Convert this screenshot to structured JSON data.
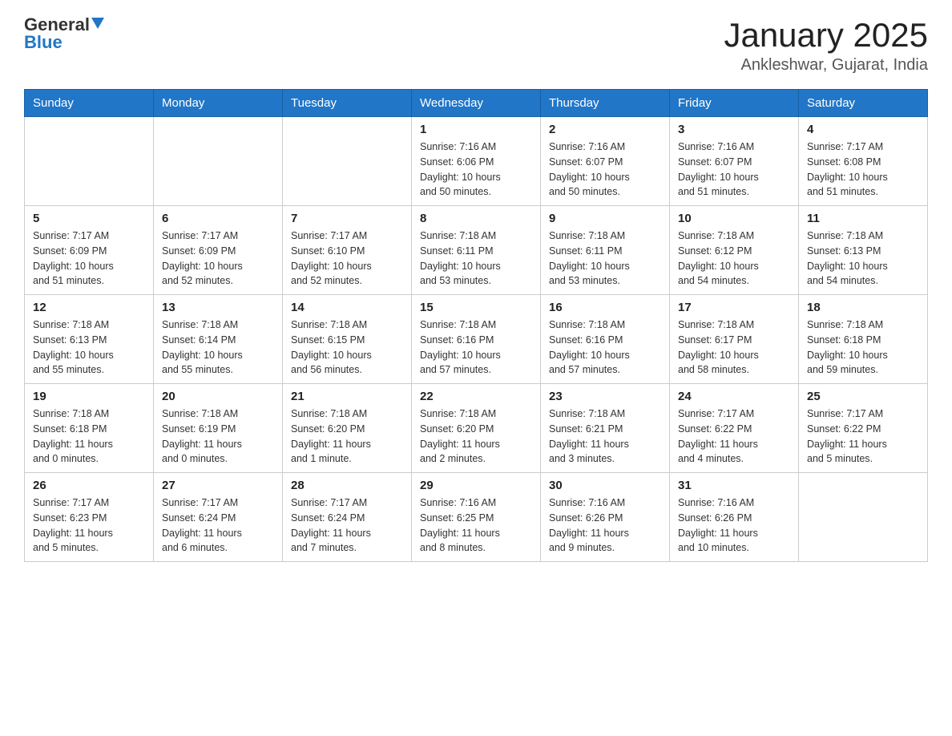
{
  "header": {
    "logo_general": "General",
    "logo_blue": "Blue",
    "title": "January 2025",
    "subtitle": "Ankleshwar, Gujarat, India"
  },
  "calendar": {
    "days_of_week": [
      "Sunday",
      "Monday",
      "Tuesday",
      "Wednesday",
      "Thursday",
      "Friday",
      "Saturday"
    ],
    "weeks": [
      [
        {
          "day": "",
          "info": ""
        },
        {
          "day": "",
          "info": ""
        },
        {
          "day": "",
          "info": ""
        },
        {
          "day": "1",
          "info": "Sunrise: 7:16 AM\nSunset: 6:06 PM\nDaylight: 10 hours\nand 50 minutes."
        },
        {
          "day": "2",
          "info": "Sunrise: 7:16 AM\nSunset: 6:07 PM\nDaylight: 10 hours\nand 50 minutes."
        },
        {
          "day": "3",
          "info": "Sunrise: 7:16 AM\nSunset: 6:07 PM\nDaylight: 10 hours\nand 51 minutes."
        },
        {
          "day": "4",
          "info": "Sunrise: 7:17 AM\nSunset: 6:08 PM\nDaylight: 10 hours\nand 51 minutes."
        }
      ],
      [
        {
          "day": "5",
          "info": "Sunrise: 7:17 AM\nSunset: 6:09 PM\nDaylight: 10 hours\nand 51 minutes."
        },
        {
          "day": "6",
          "info": "Sunrise: 7:17 AM\nSunset: 6:09 PM\nDaylight: 10 hours\nand 52 minutes."
        },
        {
          "day": "7",
          "info": "Sunrise: 7:17 AM\nSunset: 6:10 PM\nDaylight: 10 hours\nand 52 minutes."
        },
        {
          "day": "8",
          "info": "Sunrise: 7:18 AM\nSunset: 6:11 PM\nDaylight: 10 hours\nand 53 minutes."
        },
        {
          "day": "9",
          "info": "Sunrise: 7:18 AM\nSunset: 6:11 PM\nDaylight: 10 hours\nand 53 minutes."
        },
        {
          "day": "10",
          "info": "Sunrise: 7:18 AM\nSunset: 6:12 PM\nDaylight: 10 hours\nand 54 minutes."
        },
        {
          "day": "11",
          "info": "Sunrise: 7:18 AM\nSunset: 6:13 PM\nDaylight: 10 hours\nand 54 minutes."
        }
      ],
      [
        {
          "day": "12",
          "info": "Sunrise: 7:18 AM\nSunset: 6:13 PM\nDaylight: 10 hours\nand 55 minutes."
        },
        {
          "day": "13",
          "info": "Sunrise: 7:18 AM\nSunset: 6:14 PM\nDaylight: 10 hours\nand 55 minutes."
        },
        {
          "day": "14",
          "info": "Sunrise: 7:18 AM\nSunset: 6:15 PM\nDaylight: 10 hours\nand 56 minutes."
        },
        {
          "day": "15",
          "info": "Sunrise: 7:18 AM\nSunset: 6:16 PM\nDaylight: 10 hours\nand 57 minutes."
        },
        {
          "day": "16",
          "info": "Sunrise: 7:18 AM\nSunset: 6:16 PM\nDaylight: 10 hours\nand 57 minutes."
        },
        {
          "day": "17",
          "info": "Sunrise: 7:18 AM\nSunset: 6:17 PM\nDaylight: 10 hours\nand 58 minutes."
        },
        {
          "day": "18",
          "info": "Sunrise: 7:18 AM\nSunset: 6:18 PM\nDaylight: 10 hours\nand 59 minutes."
        }
      ],
      [
        {
          "day": "19",
          "info": "Sunrise: 7:18 AM\nSunset: 6:18 PM\nDaylight: 11 hours\nand 0 minutes."
        },
        {
          "day": "20",
          "info": "Sunrise: 7:18 AM\nSunset: 6:19 PM\nDaylight: 11 hours\nand 0 minutes."
        },
        {
          "day": "21",
          "info": "Sunrise: 7:18 AM\nSunset: 6:20 PM\nDaylight: 11 hours\nand 1 minute."
        },
        {
          "day": "22",
          "info": "Sunrise: 7:18 AM\nSunset: 6:20 PM\nDaylight: 11 hours\nand 2 minutes."
        },
        {
          "day": "23",
          "info": "Sunrise: 7:18 AM\nSunset: 6:21 PM\nDaylight: 11 hours\nand 3 minutes."
        },
        {
          "day": "24",
          "info": "Sunrise: 7:17 AM\nSunset: 6:22 PM\nDaylight: 11 hours\nand 4 minutes."
        },
        {
          "day": "25",
          "info": "Sunrise: 7:17 AM\nSunset: 6:22 PM\nDaylight: 11 hours\nand 5 minutes."
        }
      ],
      [
        {
          "day": "26",
          "info": "Sunrise: 7:17 AM\nSunset: 6:23 PM\nDaylight: 11 hours\nand 5 minutes."
        },
        {
          "day": "27",
          "info": "Sunrise: 7:17 AM\nSunset: 6:24 PM\nDaylight: 11 hours\nand 6 minutes."
        },
        {
          "day": "28",
          "info": "Sunrise: 7:17 AM\nSunset: 6:24 PM\nDaylight: 11 hours\nand 7 minutes."
        },
        {
          "day": "29",
          "info": "Sunrise: 7:16 AM\nSunset: 6:25 PM\nDaylight: 11 hours\nand 8 minutes."
        },
        {
          "day": "30",
          "info": "Sunrise: 7:16 AM\nSunset: 6:26 PM\nDaylight: 11 hours\nand 9 minutes."
        },
        {
          "day": "31",
          "info": "Sunrise: 7:16 AM\nSunset: 6:26 PM\nDaylight: 11 hours\nand 10 minutes."
        },
        {
          "day": "",
          "info": ""
        }
      ]
    ]
  }
}
